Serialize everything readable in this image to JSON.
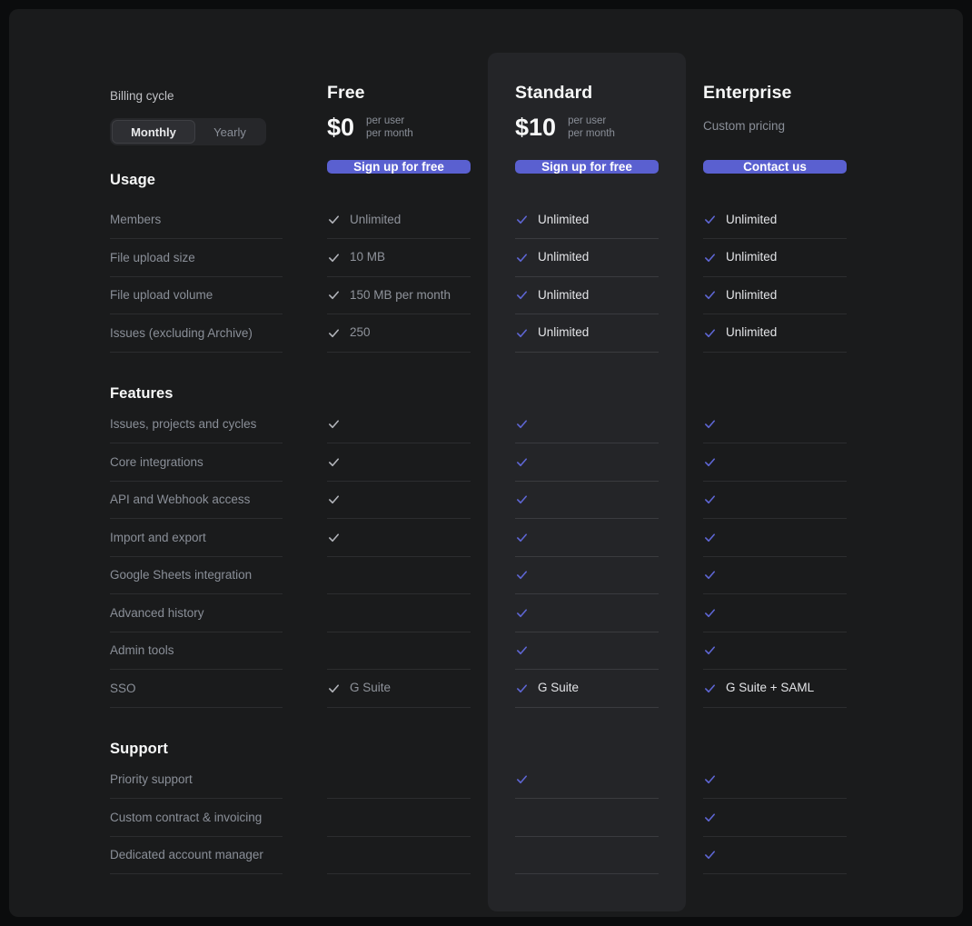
{
  "billing": {
    "label": "Billing cycle",
    "options": [
      {
        "label": "Monthly",
        "selected": true
      },
      {
        "label": "Yearly",
        "selected": false
      }
    ]
  },
  "plans": [
    {
      "name": "Free",
      "price": "$0",
      "note1": "per user",
      "note2": "per month",
      "cta": "Sign up for free",
      "highlighted": false
    },
    {
      "name": "Standard",
      "price": "$10",
      "note1": "per user",
      "note2": "per month",
      "cta": "Sign up for free",
      "highlighted": true
    },
    {
      "name": "Enterprise",
      "custom_pricing": "Custom pricing",
      "cta": "Contact us",
      "highlighted": false
    }
  ],
  "sections": [
    {
      "title": "Usage",
      "rows": [
        {
          "label": "Members",
          "free": {
            "check": true,
            "text": "Unlimited"
          },
          "standard": {
            "check": true,
            "text": "Unlimited"
          },
          "enterprise": {
            "check": true,
            "text": "Unlimited"
          }
        },
        {
          "label": "File upload size",
          "free": {
            "check": true,
            "text": "10 MB"
          },
          "standard": {
            "check": true,
            "text": "Unlimited"
          },
          "enterprise": {
            "check": true,
            "text": "Unlimited"
          }
        },
        {
          "label": "File upload volume",
          "free": {
            "check": true,
            "text": "150 MB per month"
          },
          "standard": {
            "check": true,
            "text": "Unlimited"
          },
          "enterprise": {
            "check": true,
            "text": "Unlimited"
          }
        },
        {
          "label": "Issues (excluding Archive)",
          "free": {
            "check": true,
            "text": "250"
          },
          "standard": {
            "check": true,
            "text": "Unlimited"
          },
          "enterprise": {
            "check": true,
            "text": "Unlimited"
          }
        }
      ]
    },
    {
      "title": "Features",
      "rows": [
        {
          "label": "Issues, projects and cycles",
          "free": {
            "check": true
          },
          "standard": {
            "check": true
          },
          "enterprise": {
            "check": true
          }
        },
        {
          "label": "Core integrations",
          "free": {
            "check": true
          },
          "standard": {
            "check": true
          },
          "enterprise": {
            "check": true
          }
        },
        {
          "label": "API and Webhook access",
          "free": {
            "check": true
          },
          "standard": {
            "check": true
          },
          "enterprise": {
            "check": true
          }
        },
        {
          "label": "Import and export",
          "free": {
            "check": true
          },
          "standard": {
            "check": true
          },
          "enterprise": {
            "check": true
          }
        },
        {
          "label": "Google Sheets integration",
          "free": null,
          "standard": {
            "check": true
          },
          "enterprise": {
            "check": true
          }
        },
        {
          "label": "Advanced history",
          "free": null,
          "standard": {
            "check": true
          },
          "enterprise": {
            "check": true
          }
        },
        {
          "label": "Admin tools",
          "free": null,
          "standard": {
            "check": true
          },
          "enterprise": {
            "check": true
          }
        },
        {
          "label": "SSO",
          "free": {
            "check": true,
            "text": "G Suite"
          },
          "standard": {
            "check": true,
            "text": "G Suite"
          },
          "enterprise": {
            "check": true,
            "text": "G Suite + SAML"
          }
        }
      ]
    },
    {
      "title": "Support",
      "rows": [
        {
          "label": "Priority support",
          "free": null,
          "standard": {
            "check": true
          },
          "enterprise": {
            "check": true
          }
        },
        {
          "label": "Custom contract & invoicing",
          "free": null,
          "standard": null,
          "enterprise": {
            "check": true
          }
        },
        {
          "label": "Dedicated account manager",
          "free": null,
          "standard": null,
          "enterprise": {
            "check": true
          }
        }
      ]
    }
  ],
  "colors": {
    "accent": "#5a60d0",
    "check_accent": "#5e66d4",
    "check_free": "#b2b4ba",
    "page_bg": "#0b0c0d",
    "container_bg": "#1a1b1c",
    "card_bg": "#242528",
    "label": "#8a8f98",
    "value_accent": "#e3e4e7",
    "heading": "#f7f8f8"
  }
}
